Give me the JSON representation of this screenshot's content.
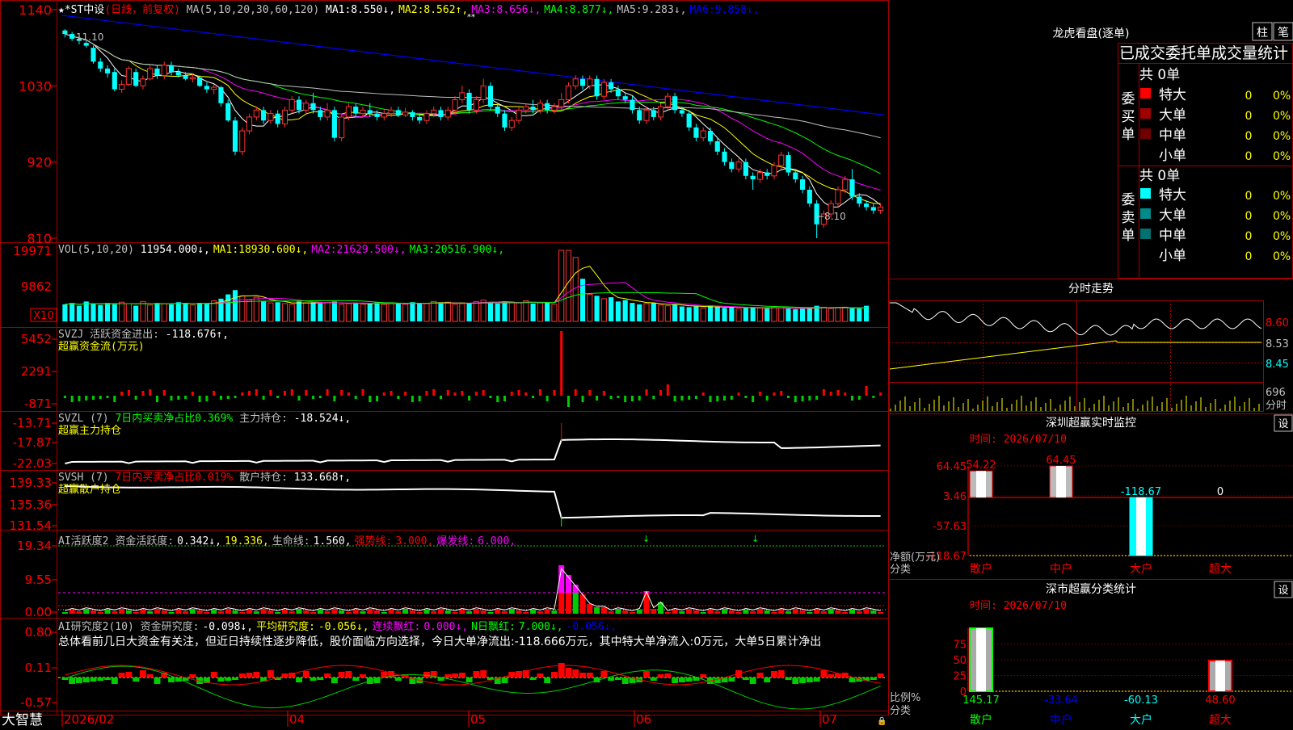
{
  "stock": {
    "name": "★*ST中设",
    "period": "(日线，前复权)",
    "ma_line": {
      "params": "MA(5,10,20,30,60,120)",
      "items": [
        {
          "label": "MA1:",
          "value": "8.550",
          "arrow": "↓",
          "color": "#ffffff"
        },
        {
          "label": "MA2:",
          "value": "8.562",
          "arrow": "↑",
          "color": "#ffff00"
        },
        {
          "label": "MA3:",
          "value": "8.656",
          "arrow": "↓",
          "color": "#ff00ff"
        },
        {
          "label": "MA4:",
          "value": "8.877",
          "arrow": "↓",
          "color": "#00ff00"
        },
        {
          "label": "MA5:",
          "value": "9.283",
          "arrow": "↓",
          "color": "#c0c0c0"
        },
        {
          "label": "MA6:",
          "value": "9.858",
          "arrow": "↓",
          "color": "#0000ff"
        }
      ]
    },
    "price_axis": [
      "1140",
      "1030",
      "920",
      "810"
    ],
    "high_marker": "11.10",
    "low_marker": "←8.10",
    "top_marker": "**"
  },
  "vol": {
    "header": "VOL(5,10,20)",
    "items": [
      {
        "label": "",
        "value": "11954.000",
        "arrow": "↓",
        "color": "#ffffff"
      },
      {
        "label": "MA1:",
        "value": "18930.600",
        "arrow": "↓",
        "color": "#ffff00"
      },
      {
        "label": "MA2:",
        "value": "21629.500",
        "arrow": "↓",
        "color": "#ff00ff"
      },
      {
        "label": "MA3:",
        "value": "20516.900",
        "arrow": "↓",
        "color": "#00ff00"
      }
    ],
    "axis": [
      "19971",
      "9862",
      "X10"
    ]
  },
  "svzj": {
    "header": "SVZJ  活跃资金进出:",
    "value": "-118.676↑,",
    "subtitle": "超赢资金流(万元)",
    "axis": [
      "5452",
      "2291",
      "-871"
    ]
  },
  "svzl": {
    "header": "SVZL (7)",
    "green_text": "7日内买卖净占比0.369%",
    "label2": "主力持仓:",
    "value": "-18.524↓,",
    "subtitle": "超赢主力持仓",
    "axis": [
      "-13.71",
      "-17.87",
      "-22.03"
    ]
  },
  "svsh": {
    "header": "SVSH (7)",
    "red_text": "7日内买卖净占比0.019%",
    "label2": "散户持仓:",
    "value": "133.668↑,",
    "subtitle": "超赢散户持仓",
    "axis": [
      "139.33",
      "135.36",
      "131.54"
    ]
  },
  "ai_active": {
    "header": "AI活跃度2",
    "items": [
      {
        "text": "资金活跃度:",
        "color": "#c0c0c0"
      },
      {
        "text": "0.342↓,",
        "color": "#ffffff"
      },
      {
        "text": "19.336,",
        "color": "#ffff00"
      },
      {
        "text": "生命线:",
        "color": "#c0c0c0"
      },
      {
        "text": "1.560,",
        "color": "#ffffff"
      },
      {
        "text": "强势线:",
        "color": "#ff0000"
      },
      {
        "text": "3.000,",
        "color": "#ff0000"
      },
      {
        "text": "爆发线:",
        "color": "#ff00ff"
      },
      {
        "text": "6.000,",
        "color": "#ff00ff"
      }
    ],
    "axis": [
      "19.34",
      "9.55",
      "0.00"
    ]
  },
  "ai_research": {
    "header": "AI研究度2(10)",
    "items": [
      {
        "text": "资金研究度:",
        "color": "#c0c0c0"
      },
      {
        "text": "-0.098↓,",
        "color": "#ffffff"
      },
      {
        "text": "平均研究度:",
        "color": "#ffff00"
      },
      {
        "text": "-0.056↓,",
        "color": "#ffff00"
      },
      {
        "text": "连续飘红:",
        "color": "#ff00ff"
      },
      {
        "text": "0.000↓,",
        "color": "#ff00ff"
      },
      {
        "text": "N日飘红:",
        "color": "#00ff00"
      },
      {
        "text": "7.000↓,",
        "color": "#00ff00"
      },
      {
        "text": "-0.056↓,",
        "color": "#0000ff"
      }
    ],
    "summary": "总体看前几日大资金有关注，但近日持续性逐步降低，股价面临方向选择，今日大单净流出:-118.666万元，其中特大单净流入:0万元，大单5日累计净出",
    "axis": [
      "0.80",
      "0.11",
      "-0.57"
    ]
  },
  "date_axis": {
    "brand": "大智慧",
    "labels": [
      "2026/02",
      "04",
      "05",
      "06",
      "07"
    ]
  },
  "right": {
    "lhb_title": "龙虎看盘(逐单)",
    "tab_zhu": "柱",
    "tab_bi": "笔",
    "stats_title": "已成交委托单成交量统计",
    "buy_side": "委买单",
    "sell_side": "委卖单",
    "buy_total": "共 0单",
    "sell_total": "共 0单",
    "buy_rows": [
      {
        "label": "特大",
        "count": "0",
        "pct": "0%",
        "color": "#ff0000"
      },
      {
        "label": "大单",
        "count": "0",
        "pct": "0%",
        "color": "#a00000"
      },
      {
        "label": "中单",
        "count": "0",
        "pct": "0%",
        "color": "#700000"
      },
      {
        "label": "小单",
        "count": "0",
        "pct": "0%",
        "color": ""
      }
    ],
    "sell_rows": [
      {
        "label": "特大",
        "count": "0",
        "pct": "0%",
        "color": "#00ffff"
      },
      {
        "label": "大单",
        "count": "0",
        "pct": "0%",
        "color": "#008b8b"
      },
      {
        "label": "中单",
        "count": "0",
        "pct": "0%",
        "color": "#007070"
      },
      {
        "label": "小单",
        "count": "0",
        "pct": "0%",
        "color": ""
      }
    ],
    "intraday_title": "分时走势",
    "intraday_axis": [
      "8.60",
      "8.53",
      "8.45"
    ],
    "intraday_vol": "696",
    "intraday_vol_label": "分时",
    "monitor_title": "深圳超赢实时监控",
    "set_label": "设",
    "monitor_time": "时间: 2026/07/10",
    "monitor_axis": [
      "64.45",
      "3.46",
      "-57.63",
      "-118.67"
    ],
    "monitor_axis_label1": "净额(万元)",
    "monitor_axis_label2": "分类",
    "monitor_bars": [
      {
        "label": "54.22",
        "value": 54.22
      },
      {
        "label": "64.45",
        "value": 64.45
      },
      {
        "label": "-118.67",
        "value": -118.67
      },
      {
        "label": "0",
        "value": 0
      }
    ],
    "categories": [
      "散户",
      "中户",
      "大户",
      "超大"
    ],
    "class_title": "深市超赢分类统计",
    "class_time": "时间: 2026/07/10",
    "class_axis": [
      "75",
      "50",
      "25",
      "0"
    ],
    "class_axis_label1": "比例%",
    "class_axis_label2": "分类",
    "class_values": [
      {
        "text": "145.17",
        "pct": 100,
        "color": "#00ff00"
      },
      {
        "text": "-33.64",
        "pct": 0,
        "color": "#0000ff"
      },
      {
        "text": "-60.13",
        "pct": 0,
        "color": "#00ffff"
      },
      {
        "text": "48.60",
        "pct": 48.6,
        "color": "#ff0000"
      }
    ]
  },
  "chart_data": {
    "type": "candlestick",
    "title": "★*ST中设",
    "ylim": [
      8.1,
      11.4
    ],
    "candles": [
      [
        11.1,
        11.05,
        11.12,
        11.0
      ],
      [
        11.05,
        10.98,
        11.08,
        10.95
      ],
      [
        10.98,
        10.95,
        11.02,
        10.9
      ],
      [
        10.92,
        10.88,
        10.95,
        10.85
      ],
      [
        10.85,
        10.65,
        10.88,
        10.62
      ],
      [
        10.65,
        10.55,
        10.7,
        10.5
      ],
      [
        10.55,
        10.48,
        10.6,
        10.42
      ],
      [
        10.5,
        10.25,
        10.55,
        10.22
      ],
      [
        10.25,
        10.32,
        10.38,
        10.2
      ],
      [
        10.32,
        10.55,
        10.58,
        10.3
      ],
      [
        10.5,
        10.3,
        10.55,
        10.28
      ],
      [
        10.3,
        10.4,
        10.45,
        10.25
      ],
      [
        10.4,
        10.55,
        10.6,
        10.38
      ],
      [
        10.55,
        10.45,
        10.6,
        10.4
      ],
      [
        10.45,
        10.6,
        10.65,
        10.4
      ],
      [
        10.6,
        10.5,
        10.65,
        10.45
      ],
      [
        10.5,
        10.45,
        10.55,
        10.42
      ],
      [
        10.45,
        10.4,
        10.5,
        10.38
      ],
      [
        10.4,
        10.42,
        10.48,
        10.35
      ],
      [
        10.42,
        10.3,
        10.45,
        10.28
      ],
      [
        10.3,
        10.25,
        10.35,
        10.2
      ],
      [
        10.25,
        10.28,
        10.32,
        10.18
      ],
      [
        10.28,
        10.05,
        10.3,
        10.0
      ],
      [
        10.05,
        9.8,
        10.1,
        9.78
      ],
      [
        9.8,
        9.35,
        9.85,
        9.3
      ],
      [
        9.35,
        9.65,
        9.7,
        9.3
      ],
      [
        9.65,
        9.85,
        9.9,
        9.6
      ],
      [
        9.85,
        9.95,
        10.0,
        9.8
      ],
      [
        9.95,
        9.8,
        10.0,
        9.75
      ],
      [
        9.8,
        9.9,
        9.95,
        9.75
      ],
      [
        9.9,
        9.75,
        9.95,
        9.7
      ],
      [
        9.75,
        9.95,
        10.0,
        9.7
      ],
      [
        9.95,
        10.1,
        10.15,
        9.9
      ],
      [
        10.1,
        9.95,
        10.15,
        9.9
      ],
      [
        9.95,
        10.05,
        10.1,
        9.9
      ],
      [
        10.05,
        9.95,
        10.2,
        9.9
      ],
      [
        9.95,
        9.85,
        10.0,
        9.8
      ],
      [
        9.85,
        9.95,
        10.05,
        9.8
      ],
      [
        9.95,
        9.55,
        10.0,
        9.5
      ],
      [
        9.55,
        9.85,
        9.9,
        9.5
      ],
      [
        9.85,
        10.0,
        10.05,
        9.8
      ],
      [
        10.0,
        9.9,
        10.05,
        9.85
      ],
      [
        9.9,
        9.95,
        10.0,
        9.85
      ],
      [
        9.95,
        9.9,
        10.05,
        9.85
      ],
      [
        9.9,
        9.85,
        9.95,
        9.8
      ],
      [
        9.85,
        9.9,
        9.95,
        9.8
      ],
      [
        9.9,
        9.95,
        10.0,
        9.85
      ],
      [
        9.95,
        9.88,
        10.0,
        9.85
      ],
      [
        9.88,
        9.92,
        9.98,
        9.85
      ],
      [
        9.92,
        9.85,
        9.95,
        9.8
      ],
      [
        9.85,
        9.8,
        9.9,
        9.75
      ],
      [
        9.8,
        9.9,
        9.95,
        9.75
      ],
      [
        9.9,
        9.95,
        10.0,
        9.85
      ],
      [
        9.95,
        9.85,
        10.0,
        9.8
      ],
      [
        9.85,
        9.95,
        10.0,
        9.8
      ],
      [
        9.95,
        10.1,
        10.15,
        9.9
      ],
      [
        10.1,
        10.2,
        10.3,
        10.05
      ],
      [
        10.2,
        9.95,
        10.25,
        9.9
      ],
      [
        9.95,
        10.1,
        10.15,
        9.9
      ],
      [
        10.1,
        10.3,
        10.4,
        10.05
      ],
      [
        10.3,
        10.0,
        10.35,
        9.95
      ],
      [
        10.0,
        9.9,
        10.05,
        9.85
      ],
      [
        9.9,
        9.7,
        9.95,
        9.65
      ],
      [
        9.7,
        9.8,
        9.85,
        9.65
      ],
      [
        9.8,
        9.95,
        10.0,
        9.75
      ],
      [
        9.95,
        10.0,
        10.05,
        9.9
      ],
      [
        10.0,
        9.95,
        10.1,
        9.9
      ],
      [
        9.95,
        10.05,
        10.1,
        9.9
      ],
      [
        10.05,
        9.95,
        10.1,
        9.9
      ],
      [
        9.95,
        10.0,
        10.05,
        9.9
      ],
      [
        10.0,
        10.1,
        10.2,
        9.95
      ],
      [
        10.1,
        10.3,
        10.35,
        10.05
      ],
      [
        10.3,
        10.4,
        10.45,
        10.25
      ],
      [
        10.4,
        10.3,
        10.45,
        10.25
      ],
      [
        10.3,
        10.4,
        10.45,
        10.25
      ],
      [
        10.4,
        10.15,
        10.45,
        10.1
      ],
      [
        10.15,
        10.35,
        10.4,
        10.1
      ],
      [
        10.35,
        10.25,
        10.4,
        10.2
      ],
      [
        10.25,
        10.15,
        10.3,
        10.1
      ],
      [
        10.15,
        10.1,
        10.2,
        10.05
      ],
      [
        10.1,
        9.95,
        10.15,
        9.9
      ],
      [
        9.95,
        9.8,
        10.0,
        9.75
      ],
      [
        9.8,
        9.95,
        10.0,
        9.75
      ],
      [
        9.95,
        9.85,
        10.0,
        9.8
      ],
      [
        9.85,
        10.0,
        10.05,
        9.8
      ],
      [
        10.0,
        10.15,
        10.2,
        9.95
      ],
      [
        10.15,
        9.95,
        10.2,
        9.9
      ],
      [
        9.95,
        9.9,
        10.0,
        9.85
      ],
      [
        9.9,
        9.7,
        9.95,
        9.65
      ],
      [
        9.7,
        9.55,
        9.75,
        9.5
      ],
      [
        9.55,
        9.65,
        9.7,
        9.5
      ],
      [
        9.65,
        9.5,
        9.7,
        9.45
      ],
      [
        9.5,
        9.35,
        9.55,
        9.3
      ],
      [
        9.35,
        9.2,
        9.4,
        9.15
      ],
      [
        9.2,
        9.1,
        9.25,
        9.05
      ],
      [
        9.1,
        9.2,
        9.25,
        9.05
      ],
      [
        9.2,
        9.0,
        9.25,
        8.95
      ],
      [
        9.0,
        8.95,
        9.05,
        8.8
      ],
      [
        8.95,
        9.05,
        9.1,
        8.9
      ],
      [
        9.05,
        9.0,
        9.1,
        8.95
      ],
      [
        9.0,
        9.15,
        9.2,
        8.95
      ],
      [
        9.15,
        9.3,
        9.35,
        9.1
      ],
      [
        9.3,
        9.05,
        9.35,
        9.0
      ],
      [
        9.05,
        8.95,
        9.1,
        8.9
      ],
      [
        8.95,
        8.8,
        9.0,
        8.75
      ],
      [
        8.8,
        8.6,
        8.85,
        8.55
      ],
      [
        8.6,
        8.3,
        8.65,
        8.1
      ],
      [
        8.3,
        8.45,
        8.5,
        8.25
      ],
      [
        8.45,
        8.6,
        8.65,
        8.4
      ],
      [
        8.6,
        8.8,
        8.85,
        8.55
      ],
      [
        8.8,
        8.95,
        9.0,
        8.75
      ],
      [
        8.95,
        8.7,
        9.1,
        8.65
      ],
      [
        8.7,
        8.6,
        8.75,
        8.55
      ],
      [
        8.6,
        8.55,
        8.65,
        8.5
      ],
      [
        8.55,
        8.5,
        8.6,
        8.45
      ],
      [
        8.5,
        8.55,
        8.6,
        8.45
      ]
    ],
    "volume_x10": [
      1200,
      1300,
      1100,
      1400,
      1250,
      1150,
      1300,
      1200,
      1350,
      1250,
      1100,
      1400,
      1150,
      1300,
      1250,
      1200,
      1350,
      1280,
      1150,
      1300,
      1250,
      1450,
      1600,
      1900,
      2200,
      1800,
      1500,
      1700,
      1400,
      1300,
      1350,
      1250,
      1200,
      1400,
      1300,
      1350,
      1250,
      1300,
      1400,
      1200,
      1250,
      1300,
      1200,
      1250,
      1350,
      1200,
      1300,
      1250,
      1200,
      1350,
      1300,
      1250,
      1400,
      1300,
      1350,
      1200,
      1250,
      1300,
      1400,
      1500,
      1300,
      1250,
      1400,
      1350,
      1300,
      1450,
      1250,
      1300,
      1350,
      1200,
      5000,
      5000,
      4500,
      3000,
      1900,
      1800,
      1600,
      1700,
      1400,
      1500,
      1300,
      1200,
      1250,
      1300,
      1150,
      1100,
      1200,
      1050,
      1000,
      1050,
      950,
      1100,
      1000,
      950,
      1050,
      900,
      950,
      1000,
      950,
      900,
      1000,
      950,
      900,
      850,
      900,
      950,
      1100,
      1000,
      900,
      950,
      1000,
      950,
      900,
      1100
    ],
    "series": [
      {
        "name": "MA1",
        "color": "#ffffff"
      },
      {
        "name": "MA2",
        "color": "#ffff00"
      },
      {
        "name": "MA3",
        "color": "#ff00ff"
      },
      {
        "name": "MA4",
        "color": "#00ff00"
      },
      {
        "name": "MA5",
        "color": "#c0c0c0"
      },
      {
        "name": "MA6",
        "color": "#0000ff"
      }
    ]
  }
}
